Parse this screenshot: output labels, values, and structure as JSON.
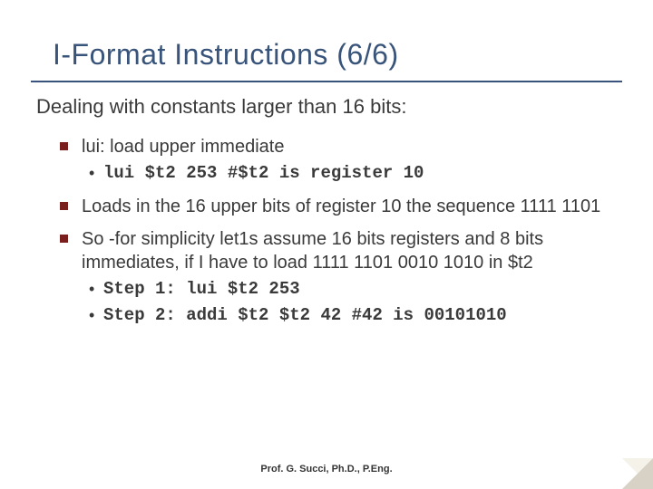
{
  "title": "I-Format Instructions (6/6)",
  "subtitle": "Dealing with constants larger than 16 bits:",
  "points": {
    "p1": "lui: load upper immediate",
    "p1a": "lui $t2 253 #$t2 is register 10",
    "p2": "Loads in the 16 upper bits of register 10 the sequence 1111 1101",
    "p3": "So -for simplicity let1s assume 16 bits registers and 8 bits immediates, if I have to load 1111 1101 0010 1010 in $t2",
    "p3a": "Step 1: lui $t2 253",
    "p3b": "Step 2: addi $t2 $t2 42 #42 is 00101010"
  },
  "footer": "Prof. G. Succi, Ph.D., P.Eng."
}
